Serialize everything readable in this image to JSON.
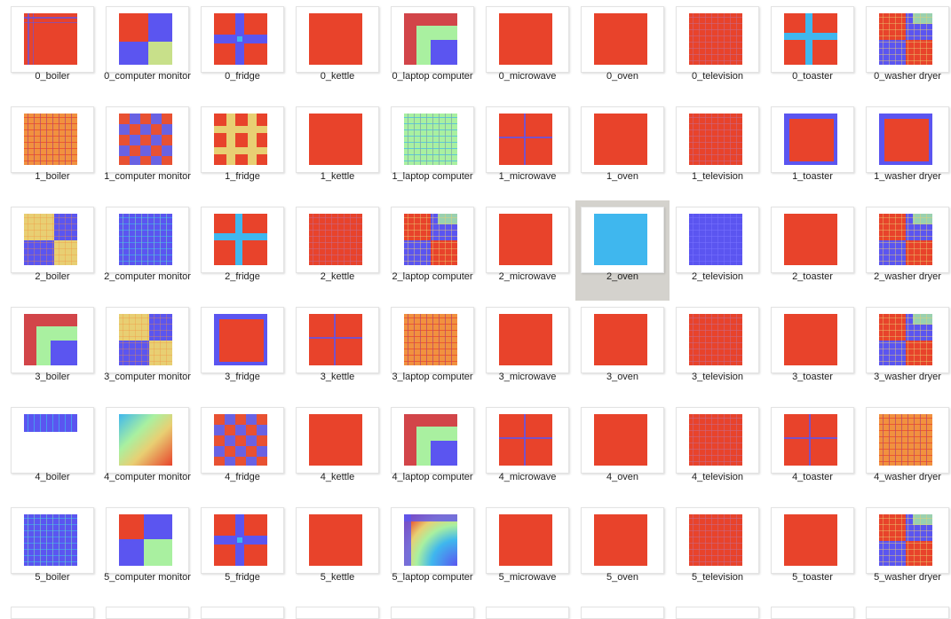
{
  "colors": {
    "red": "#e8432b",
    "blue": "#5b55f0",
    "cyan": "#3fb7ee",
    "yellow": "#e8cf73",
    "green": "#a9f0a0",
    "orange": "#f1913f",
    "selection": "#d4d2cd"
  },
  "rows": [
    {
      "index": 0,
      "items": [
        {
          "label": "0_boiler",
          "style": "lines"
        },
        {
          "label": "0_computer monitor",
          "style": "quad"
        },
        {
          "label": "0_fridge",
          "style": "cross-blue"
        },
        {
          "label": "0_kettle",
          "style": "red"
        },
        {
          "label": "0_laptop computer",
          "style": "green-box"
        },
        {
          "label": "0_microwave",
          "style": "red"
        },
        {
          "label": "0_oven",
          "style": "red"
        },
        {
          "label": "0_television",
          "style": "red-lines"
        },
        {
          "label": "0_toaster",
          "style": "cross-cyan"
        },
        {
          "label": "0_washer dryer",
          "style": "mixed"
        }
      ]
    },
    {
      "index": 1,
      "items": [
        {
          "label": "1_boiler",
          "style": "orange-grid"
        },
        {
          "label": "1_computer monitor",
          "style": "checker"
        },
        {
          "label": "1_fridge",
          "style": "yellow-grid"
        },
        {
          "label": "1_kettle",
          "style": "red"
        },
        {
          "label": "1_laptop computer",
          "style": "green-grid"
        },
        {
          "label": "1_microwave",
          "style": "red-cross"
        },
        {
          "label": "1_oven",
          "style": "red"
        },
        {
          "label": "1_television",
          "style": "red-lines"
        },
        {
          "label": "1_toaster",
          "style": "red-edge"
        },
        {
          "label": "1_washer dryer",
          "style": "red-edge"
        }
      ]
    },
    {
      "index": 2,
      "items": [
        {
          "label": "2_boiler",
          "style": "yellow-quad"
        },
        {
          "label": "2_computer monitor",
          "style": "blue-grid"
        },
        {
          "label": "2_fridge",
          "style": "cross-cyan"
        },
        {
          "label": "2_kettle",
          "style": "red-lines"
        },
        {
          "label": "2_laptop computer",
          "style": "mixed"
        },
        {
          "label": "2_microwave",
          "style": "red"
        },
        {
          "label": "2_oven",
          "style": "cyan",
          "selected": true
        },
        {
          "label": "2_television",
          "style": "blue"
        },
        {
          "label": "2_toaster",
          "style": "red"
        },
        {
          "label": "2_washer dryer",
          "style": "mixed"
        }
      ]
    },
    {
      "index": 3,
      "items": [
        {
          "label": "3_boiler",
          "style": "green-box"
        },
        {
          "label": "3_computer monitor",
          "style": "yellow-quad"
        },
        {
          "label": "3_fridge",
          "style": "red-edge"
        },
        {
          "label": "3_kettle",
          "style": "red-cross"
        },
        {
          "label": "3_laptop computer",
          "style": "orange-grid"
        },
        {
          "label": "3_microwave",
          "style": "red"
        },
        {
          "label": "3_oven",
          "style": "red"
        },
        {
          "label": "3_television",
          "style": "red-lines"
        },
        {
          "label": "3_toaster",
          "style": "red"
        },
        {
          "label": "3_washer dryer",
          "style": "mixed"
        }
      ]
    },
    {
      "index": 4,
      "items": [
        {
          "label": "4_boiler",
          "style": "strip"
        },
        {
          "label": "4_computer monitor",
          "style": "gradient"
        },
        {
          "label": "4_fridge",
          "style": "checker"
        },
        {
          "label": "4_kettle",
          "style": "red"
        },
        {
          "label": "4_laptop computer",
          "style": "green-box"
        },
        {
          "label": "4_microwave",
          "style": "red-cross"
        },
        {
          "label": "4_oven",
          "style": "red"
        },
        {
          "label": "4_television",
          "style": "red-lines"
        },
        {
          "label": "4_toaster",
          "style": "red-cross"
        },
        {
          "label": "4_washer dryer",
          "style": "orange-grid"
        }
      ]
    },
    {
      "index": 5,
      "items": [
        {
          "label": "5_boiler",
          "style": "blue-grid"
        },
        {
          "label": "5_computer monitor",
          "style": "quad-blue"
        },
        {
          "label": "5_fridge",
          "style": "cross-blue"
        },
        {
          "label": "5_kettle",
          "style": "red"
        },
        {
          "label": "5_laptop computer",
          "style": "swirl"
        },
        {
          "label": "5_microwave",
          "style": "red"
        },
        {
          "label": "5_oven",
          "style": "red"
        },
        {
          "label": "5_television",
          "style": "red-lines"
        },
        {
          "label": "5_toaster",
          "style": "red"
        },
        {
          "label": "5_washer dryer",
          "style": "mixed"
        }
      ]
    }
  ]
}
